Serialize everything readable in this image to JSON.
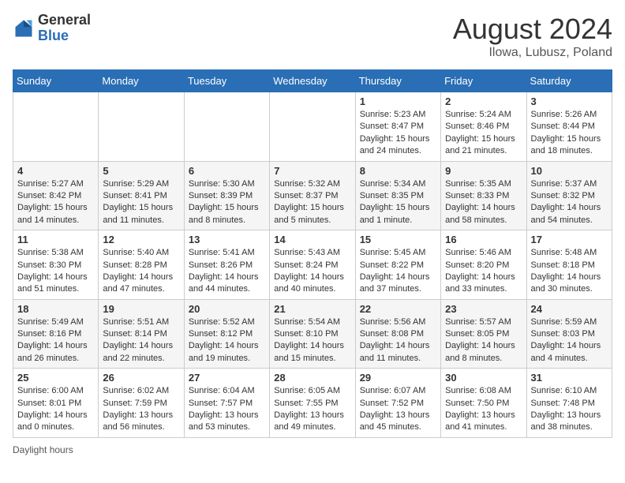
{
  "header": {
    "logo_general": "General",
    "logo_blue": "Blue",
    "month_year": "August 2024",
    "location": "Ilowa, Lubusz, Poland"
  },
  "footer": {
    "daylight_label": "Daylight hours"
  },
  "weekdays": [
    "Sunday",
    "Monday",
    "Tuesday",
    "Wednesday",
    "Thursday",
    "Friday",
    "Saturday"
  ],
  "weeks": [
    [
      {
        "day": "",
        "info": ""
      },
      {
        "day": "",
        "info": ""
      },
      {
        "day": "",
        "info": ""
      },
      {
        "day": "",
        "info": ""
      },
      {
        "day": "1",
        "info": "Sunrise: 5:23 AM\nSunset: 8:47 PM\nDaylight: 15 hours\nand 24 minutes."
      },
      {
        "day": "2",
        "info": "Sunrise: 5:24 AM\nSunset: 8:46 PM\nDaylight: 15 hours\nand 21 minutes."
      },
      {
        "day": "3",
        "info": "Sunrise: 5:26 AM\nSunset: 8:44 PM\nDaylight: 15 hours\nand 18 minutes."
      }
    ],
    [
      {
        "day": "4",
        "info": "Sunrise: 5:27 AM\nSunset: 8:42 PM\nDaylight: 15 hours\nand 14 minutes."
      },
      {
        "day": "5",
        "info": "Sunrise: 5:29 AM\nSunset: 8:41 PM\nDaylight: 15 hours\nand 11 minutes."
      },
      {
        "day": "6",
        "info": "Sunrise: 5:30 AM\nSunset: 8:39 PM\nDaylight: 15 hours\nand 8 minutes."
      },
      {
        "day": "7",
        "info": "Sunrise: 5:32 AM\nSunset: 8:37 PM\nDaylight: 15 hours\nand 5 minutes."
      },
      {
        "day": "8",
        "info": "Sunrise: 5:34 AM\nSunset: 8:35 PM\nDaylight: 15 hours\nand 1 minute."
      },
      {
        "day": "9",
        "info": "Sunrise: 5:35 AM\nSunset: 8:33 PM\nDaylight: 14 hours\nand 58 minutes."
      },
      {
        "day": "10",
        "info": "Sunrise: 5:37 AM\nSunset: 8:32 PM\nDaylight: 14 hours\nand 54 minutes."
      }
    ],
    [
      {
        "day": "11",
        "info": "Sunrise: 5:38 AM\nSunset: 8:30 PM\nDaylight: 14 hours\nand 51 minutes."
      },
      {
        "day": "12",
        "info": "Sunrise: 5:40 AM\nSunset: 8:28 PM\nDaylight: 14 hours\nand 47 minutes."
      },
      {
        "day": "13",
        "info": "Sunrise: 5:41 AM\nSunset: 8:26 PM\nDaylight: 14 hours\nand 44 minutes."
      },
      {
        "day": "14",
        "info": "Sunrise: 5:43 AM\nSunset: 8:24 PM\nDaylight: 14 hours\nand 40 minutes."
      },
      {
        "day": "15",
        "info": "Sunrise: 5:45 AM\nSunset: 8:22 PM\nDaylight: 14 hours\nand 37 minutes."
      },
      {
        "day": "16",
        "info": "Sunrise: 5:46 AM\nSunset: 8:20 PM\nDaylight: 14 hours\nand 33 minutes."
      },
      {
        "day": "17",
        "info": "Sunrise: 5:48 AM\nSunset: 8:18 PM\nDaylight: 14 hours\nand 30 minutes."
      }
    ],
    [
      {
        "day": "18",
        "info": "Sunrise: 5:49 AM\nSunset: 8:16 PM\nDaylight: 14 hours\nand 26 minutes."
      },
      {
        "day": "19",
        "info": "Sunrise: 5:51 AM\nSunset: 8:14 PM\nDaylight: 14 hours\nand 22 minutes."
      },
      {
        "day": "20",
        "info": "Sunrise: 5:52 AM\nSunset: 8:12 PM\nDaylight: 14 hours\nand 19 minutes."
      },
      {
        "day": "21",
        "info": "Sunrise: 5:54 AM\nSunset: 8:10 PM\nDaylight: 14 hours\nand 15 minutes."
      },
      {
        "day": "22",
        "info": "Sunrise: 5:56 AM\nSunset: 8:08 PM\nDaylight: 14 hours\nand 11 minutes."
      },
      {
        "day": "23",
        "info": "Sunrise: 5:57 AM\nSunset: 8:05 PM\nDaylight: 14 hours\nand 8 minutes."
      },
      {
        "day": "24",
        "info": "Sunrise: 5:59 AM\nSunset: 8:03 PM\nDaylight: 14 hours\nand 4 minutes."
      }
    ],
    [
      {
        "day": "25",
        "info": "Sunrise: 6:00 AM\nSunset: 8:01 PM\nDaylight: 14 hours\nand 0 minutes."
      },
      {
        "day": "26",
        "info": "Sunrise: 6:02 AM\nSunset: 7:59 PM\nDaylight: 13 hours\nand 56 minutes."
      },
      {
        "day": "27",
        "info": "Sunrise: 6:04 AM\nSunset: 7:57 PM\nDaylight: 13 hours\nand 53 minutes."
      },
      {
        "day": "28",
        "info": "Sunrise: 6:05 AM\nSunset: 7:55 PM\nDaylight: 13 hours\nand 49 minutes."
      },
      {
        "day": "29",
        "info": "Sunrise: 6:07 AM\nSunset: 7:52 PM\nDaylight: 13 hours\nand 45 minutes."
      },
      {
        "day": "30",
        "info": "Sunrise: 6:08 AM\nSunset: 7:50 PM\nDaylight: 13 hours\nand 41 minutes."
      },
      {
        "day": "31",
        "info": "Sunrise: 6:10 AM\nSunset: 7:48 PM\nDaylight: 13 hours\nand 38 minutes."
      }
    ]
  ]
}
